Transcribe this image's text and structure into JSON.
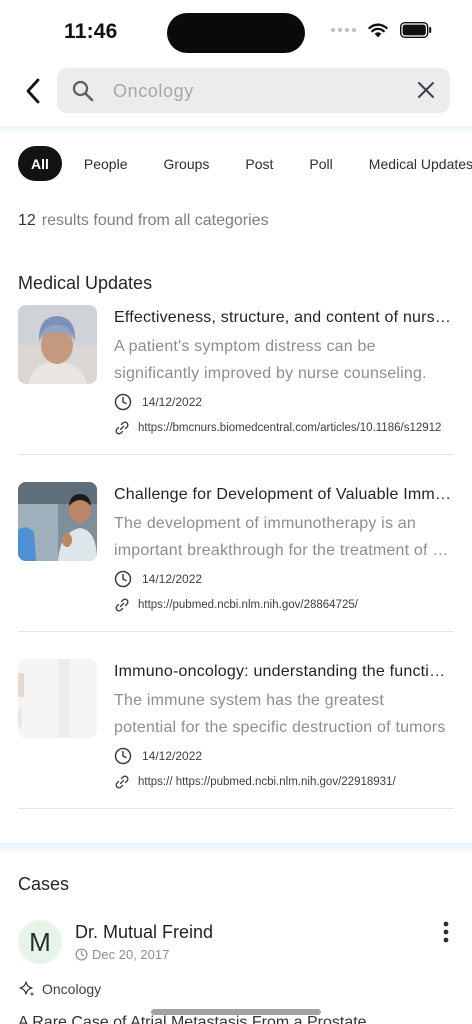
{
  "status_bar": {
    "time": "11:46"
  },
  "search": {
    "value": "Oncology"
  },
  "filters": [
    "All",
    "People",
    "Groups",
    "Post",
    "Poll",
    "Medical Updates"
  ],
  "results": {
    "count": "12",
    "text": "results found from all categories"
  },
  "medical_updates": {
    "title": "Medical Updates",
    "items": [
      {
        "title": "Effectiveness, structure, and content of nurse counseling in cancer care",
        "desc_line1": "A patient's symptom distress can be",
        "desc_line2": "significantly improved by nurse counseling.",
        "date": "14/12/2022",
        "link": "https://bmcnurs.biomedcentral.com/articles/10.1186/s12912"
      },
      {
        "title": "Challenge for Development of Valuable Immuno-oncology Drugs",
        "desc_line1": "The development of immunotherapy is an",
        "desc_line2": "important breakthrough for the treatment of cancer",
        "date": "14/12/2022",
        "link": "https://pubmed.ncbi.nlm.nih.gov/28864725/"
      },
      {
        "title": "Immuno-oncology: understanding the function and dysfunction of the immune system",
        "desc_line1": "The immune system has the greatest",
        "desc_line2": "potential for the specific destruction of tumors",
        "date": "14/12/2022",
        "link": "https:// https://pubmed.ncbi.nlm.nih.gov/22918931/"
      }
    ]
  },
  "cases": {
    "title": "Cases",
    "card": {
      "avatar_initial": "M",
      "name": "Dr. Mutual Freind",
      "date": "Dec 20, 2017",
      "tag": "Oncology",
      "cutoff_text": "A Rare Case of Atrial Metastasis From a Prostate"
    }
  },
  "icons": {
    "back": "chevron-left-icon",
    "search": "search-icon",
    "clear": "close-icon",
    "date": "clock-icon",
    "link": "link-icon",
    "more": "more-vertical-icon",
    "tag": "sparkle-icon"
  },
  "colors": {
    "chip_active_bg": "#111214",
    "avatar_bg": "#e6f5e7",
    "divider": "#e2f2f8"
  }
}
